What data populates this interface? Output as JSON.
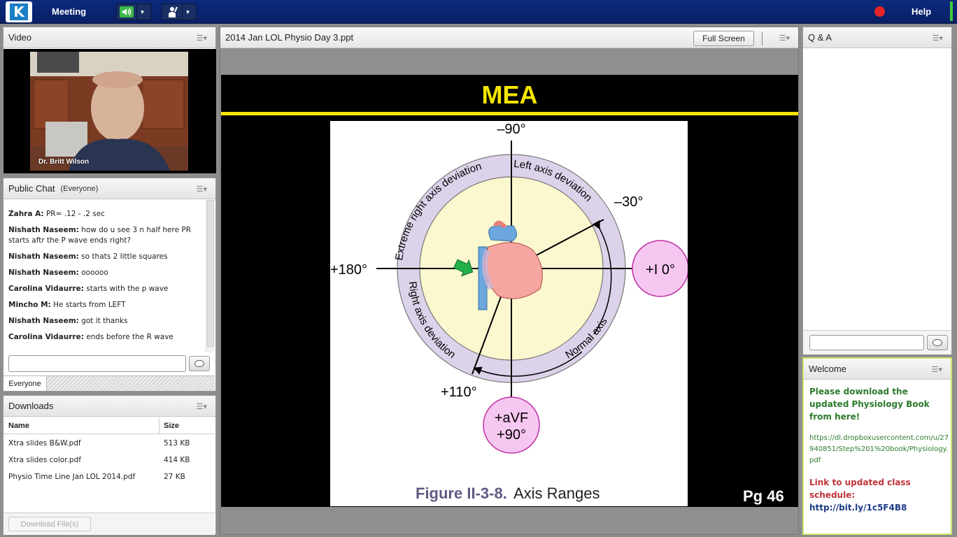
{
  "app": {
    "menu_meeting": "Meeting",
    "help": "Help",
    "accent_blue": "#0c2a7c",
    "record_color": "#e8232a"
  },
  "video": {
    "title": "Video",
    "presenter_name": "Dr. Britt Wilson"
  },
  "chat": {
    "title": "Public Chat",
    "scope": "(Everyone)",
    "messages": [
      {
        "sender": "Zahra A:",
        "text": "PR= .12 - .2 sec"
      },
      {
        "sender": "Nishath Naseem:",
        "text": "how do u see 3 n half here PR starts aftr the P wave ends right?"
      },
      {
        "sender": "Nishath Naseem:",
        "text": "so thats 2 little squares"
      },
      {
        "sender": "Nishath Naseem:",
        "text": "oooooo"
      },
      {
        "sender": "Carolina Vidaurre:",
        "text": "starts with the p wave"
      },
      {
        "sender": "Mincho M:",
        "text": "He starts from LEFT"
      },
      {
        "sender": "Nishath Naseem:",
        "text": "got it thanks"
      },
      {
        "sender": "Carolina Vidaurre:",
        "text": "ends before the R wave"
      }
    ],
    "tab_label": "Everyone"
  },
  "downloads": {
    "title": "Downloads",
    "columns": [
      "Name",
      "Size"
    ],
    "files": [
      {
        "name": "Xtra slides B&W.pdf",
        "size": "513 KB"
      },
      {
        "name": "Xtra slides color.pdf",
        "size": "414 KB"
      },
      {
        "name": "Physio Time Line Jan LOL 2014.pdf",
        "size": "27 KB"
      }
    ],
    "download_button": "Download File(s)"
  },
  "share": {
    "title": "2014 Jan LOL Physio Day 3.ppt",
    "full_screen_label": "Full Screen",
    "slide_title": "MEA",
    "page_label": "Pg 46",
    "figure": {
      "top_angle": "–90°",
      "left_angle": "+180°",
      "upper_right_angle": "–30°",
      "lower_left_angle": "+110°",
      "lead_i": "+I  0°",
      "avf_line1": "+aVF",
      "avf_line2": "+90°",
      "arc_left_axis": "Left axis deviation",
      "arc_extreme_right": "Extreme right axis deviation",
      "arc_right_axis": "Right axis deviation",
      "arc_normal": "Normal axis",
      "caption_number": "Figure II-3-8.",
      "caption_text": " Axis Ranges",
      "slide_yellow": "#f5e600",
      "ring_color": "#dcd3ea",
      "inner_fill": "#fbf8cf",
      "lead_circle_fill": "#f6c7f0"
    }
  },
  "qa": {
    "title": "Q & A"
  },
  "welcome": {
    "title": "Welcome",
    "line1": "Please download the updated Physiology Book from here!",
    "link": "https://dl.dropboxusercontent.com/u/27940851/Step%201%20book/Physiology.pdf",
    "line2": "Link to updated class schedule:",
    "url2": "http://bit.ly/1c5F4B8"
  }
}
